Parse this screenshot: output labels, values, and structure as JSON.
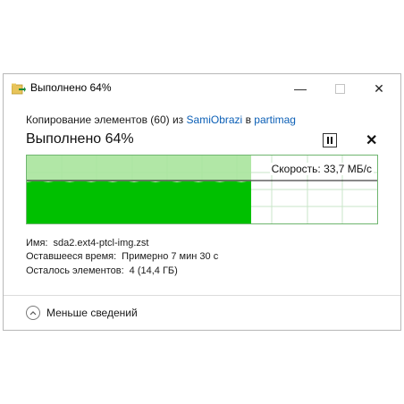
{
  "window": {
    "title": "Выполнено 64%",
    "buttons": {
      "minimize": "—",
      "close": "✕"
    }
  },
  "copy": {
    "prefix": "Копирование элементов (60) из",
    "source": "SamiObrazi",
    "middle": "в",
    "destination": "partimag"
  },
  "progress": {
    "heading": "Выполнено 64%",
    "percent": 64,
    "speed_label": "Скорость: 33,7 МБ/с",
    "pause_icon": "pause-icon",
    "cancel_symbol": "✕"
  },
  "details": {
    "name_label": "Имя:",
    "name_value": "sda2.ext4-ptcl-img.zst",
    "time_label": "Оставшееся время:",
    "time_value": "Примерно 7 мин 30 с",
    "items_label": "Осталось элементов:",
    "items_value": "4 (14,4 ГБ)"
  },
  "footer": {
    "toggle_label": "Меньше сведений"
  },
  "colors": {
    "graph_fill": "#00c000",
    "graph_progress": "#a8e49c",
    "grid": "#c8e6c8",
    "link": "#0b5fb6"
  }
}
